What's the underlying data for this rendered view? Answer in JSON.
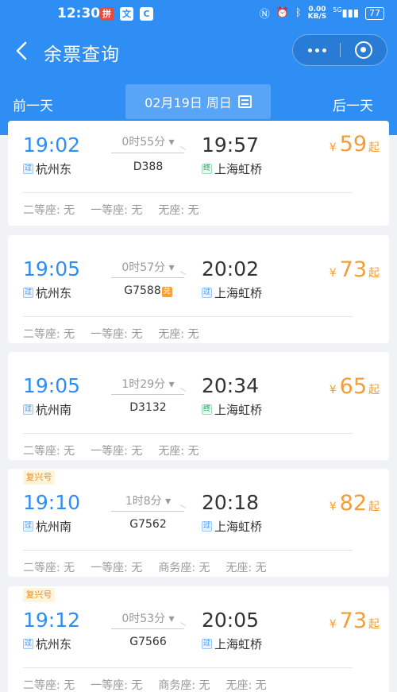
{
  "status_bar": {
    "time": "12:30",
    "app_icons": [
      "拼",
      "文",
      "C"
    ],
    "net_speed_value": "0.00",
    "net_speed_unit": "KB/S",
    "signal_label": "5G",
    "battery": "77"
  },
  "nav": {
    "title": "余票查询"
  },
  "date_bar": {
    "prev_label": "前一天",
    "date_label": "02月19日 周日",
    "next_label": "后一天"
  },
  "trains": [
    {
      "badge": "",
      "dep_time": "19:02",
      "dep_tag": "过",
      "dep_station": "杭州东",
      "duration": "0时55分",
      "train_no": "D388",
      "fu": "",
      "arr_time": "19:57",
      "arr_tag": "终",
      "arr_station": "上海虹桥",
      "price_symbol": "¥",
      "price": "59",
      "price_suffix": "起",
      "seats": [
        "二等座: 无",
        "一等座: 无",
        "无座: 无"
      ]
    },
    {
      "badge": "",
      "dep_time": "19:05",
      "dep_tag": "过",
      "dep_station": "杭州东",
      "duration": "0时57分",
      "train_no": "G7588",
      "fu": "兑",
      "arr_time": "20:02",
      "arr_tag": "过",
      "arr_station": "上海虹桥",
      "price_symbol": "¥",
      "price": "73",
      "price_suffix": "起",
      "seats": [
        "二等座: 无",
        "一等座: 无",
        "无座: 无"
      ]
    },
    {
      "badge": "",
      "dep_time": "19:05",
      "dep_tag": "过",
      "dep_station": "杭州南",
      "duration": "1时29分",
      "train_no": "D3132",
      "fu": "",
      "arr_time": "20:34",
      "arr_tag": "终",
      "arr_station": "上海虹桥",
      "price_symbol": "¥",
      "price": "65",
      "price_suffix": "起",
      "seats": [
        "二等座: 无",
        "一等座: 无",
        "无座: 无"
      ]
    },
    {
      "badge": "复兴号",
      "dep_time": "19:10",
      "dep_tag": "过",
      "dep_station": "杭州南",
      "duration": "1时8分",
      "train_no": "G7562",
      "fu": "",
      "arr_time": "20:18",
      "arr_tag": "过",
      "arr_station": "上海虹桥",
      "price_symbol": "¥",
      "price": "82",
      "price_suffix": "起",
      "seats": [
        "二等座: 无",
        "一等座: 无",
        "商务座: 无",
        "无座: 无"
      ]
    },
    {
      "badge": "复兴号",
      "dep_time": "19:12",
      "dep_tag": "过",
      "dep_station": "杭州东",
      "duration": "0时53分",
      "train_no": "G7566",
      "fu": "",
      "arr_time": "20:05",
      "arr_tag": "过",
      "arr_station": "上海虹桥",
      "price_symbol": "¥",
      "price": "73",
      "price_suffix": "起",
      "seats": [
        "二等座: 无",
        "一等座: 无",
        "商务座: 无",
        "无座: 无"
      ]
    }
  ]
}
